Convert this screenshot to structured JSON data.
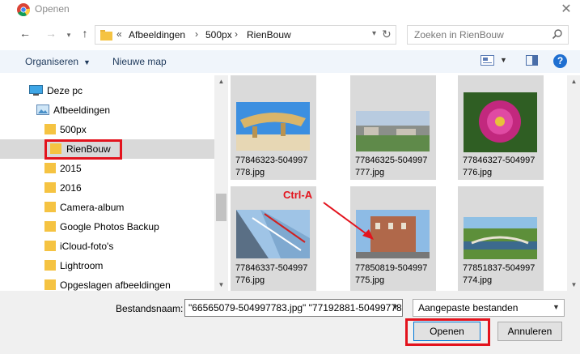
{
  "window": {
    "title": "Openen"
  },
  "address": {
    "crumbs": [
      "Afbeeldingen",
      "500px",
      "RienBouw"
    ],
    "prefix": "«"
  },
  "search": {
    "placeholder": "Zoeken in RienBouw"
  },
  "toolbar": {
    "organize": "Organiseren",
    "new_folder": "Nieuwe map",
    "help": "?"
  },
  "tree": [
    {
      "label": "Deze pc",
      "type": "pc"
    },
    {
      "label": "Afbeeldingen",
      "type": "pictures"
    },
    {
      "label": "500px",
      "type": "folder"
    },
    {
      "label": "RienBouw",
      "type": "folder",
      "selected": true
    },
    {
      "label": "2015",
      "type": "folder"
    },
    {
      "label": "2016",
      "type": "folder"
    },
    {
      "label": "Camera-album",
      "type": "folder"
    },
    {
      "label": "Google Photos Backup",
      "type": "folder"
    },
    {
      "label": "iCloud-foto's",
      "type": "folder"
    },
    {
      "label": "Lightroom",
      "type": "folder"
    },
    {
      "label": "Opgeslagen afbeeldingen",
      "type": "folder"
    }
  ],
  "files": [
    {
      "name_line1": "77846323-504997",
      "name_line2": "778.jpg"
    },
    {
      "name_line1": "77846325-504997",
      "name_line2": "777.jpg"
    },
    {
      "name_line1": "77846327-504997",
      "name_line2": "776.jpg"
    },
    {
      "name_line1": "77846337-504997",
      "name_line2": "776.jpg"
    },
    {
      "name_line1": "77850819-504997",
      "name_line2": "775.jpg"
    },
    {
      "name_line1": "77851837-504997",
      "name_line2": "774.jpg"
    }
  ],
  "annotation": {
    "text": "Ctrl-A"
  },
  "bottom": {
    "filename_label": "Bestandsnaam:",
    "filename_value": "\"66565079-504997783.jpg\" \"77192881-50499778",
    "filetype": "Aangepaste bestanden",
    "open_button": "Openen",
    "cancel_button": "Annuleren"
  },
  "colors": {
    "highlight": "#e3131d",
    "selection": "#d9d9d9",
    "folder": "#f5c342"
  }
}
